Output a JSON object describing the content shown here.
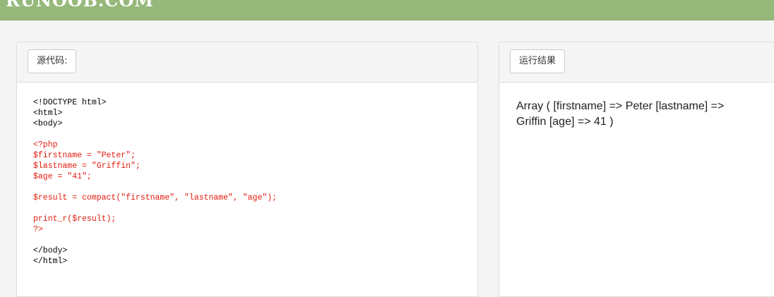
{
  "header": {
    "logo_text": "RUNOOB.COM"
  },
  "source_panel": {
    "button_label": "源代码:",
    "code_lines": [
      {
        "text": "<!DOCTYPE html>",
        "kind": "html"
      },
      {
        "text": "<html>",
        "kind": "html"
      },
      {
        "text": "<body>",
        "kind": "html"
      },
      {
        "text": "",
        "kind": "blank"
      },
      {
        "text": "<?php",
        "kind": "php"
      },
      {
        "text": "$firstname = \"Peter\";",
        "kind": "php"
      },
      {
        "text": "$lastname = \"Griffin\";",
        "kind": "php"
      },
      {
        "text": "$age = \"41\";",
        "kind": "php"
      },
      {
        "text": "",
        "kind": "blank"
      },
      {
        "text": "$result = compact(\"firstname\", \"lastname\", \"age\");",
        "kind": "php"
      },
      {
        "text": "",
        "kind": "blank"
      },
      {
        "text": "print_r($result);",
        "kind": "php"
      },
      {
        "text": "?>",
        "kind": "php"
      },
      {
        "text": "",
        "kind": "blank"
      },
      {
        "text": "</body>",
        "kind": "html"
      },
      {
        "text": "</html>",
        "kind": "html"
      }
    ]
  },
  "result_panel": {
    "button_label": "运行结果",
    "output_text": "Array ( [firstname] => Peter [lastname] => Griffin [age] => 41 )"
  },
  "colors": {
    "header_green": "#96b97b",
    "php_code_red": "#e01b0e",
    "page_background": "#f4f4f4"
  }
}
